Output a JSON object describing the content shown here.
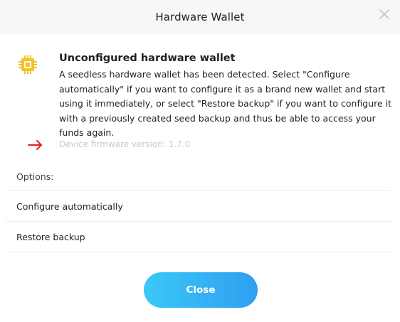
{
  "header": {
    "title": "Hardware Wallet",
    "close_icon": "close-icon"
  },
  "notice": {
    "icon": "chip-icon",
    "icon_color": "#f2c229",
    "title": "Unconfigured hardware wallet",
    "body": "A seedless hardware wallet has been detected. Select \"Configure automatically\" if you want to configure it as a brand new wallet and start using it immediately, or select \"Restore backup\" if you want to configure it with a previously created seed backup and thus be able to access your funds again.",
    "arrow_icon": "arrow-right-icon",
    "arrow_color": "#e02020",
    "firmware": "Device firmware version: 1.7.0"
  },
  "options": {
    "label": "Options:",
    "items": [
      {
        "label": "Configure automatically"
      },
      {
        "label": "Restore backup"
      }
    ]
  },
  "footer": {
    "close_label": "Close",
    "button_colors": [
      "#3bc9f7",
      "#2f9ef0"
    ]
  }
}
